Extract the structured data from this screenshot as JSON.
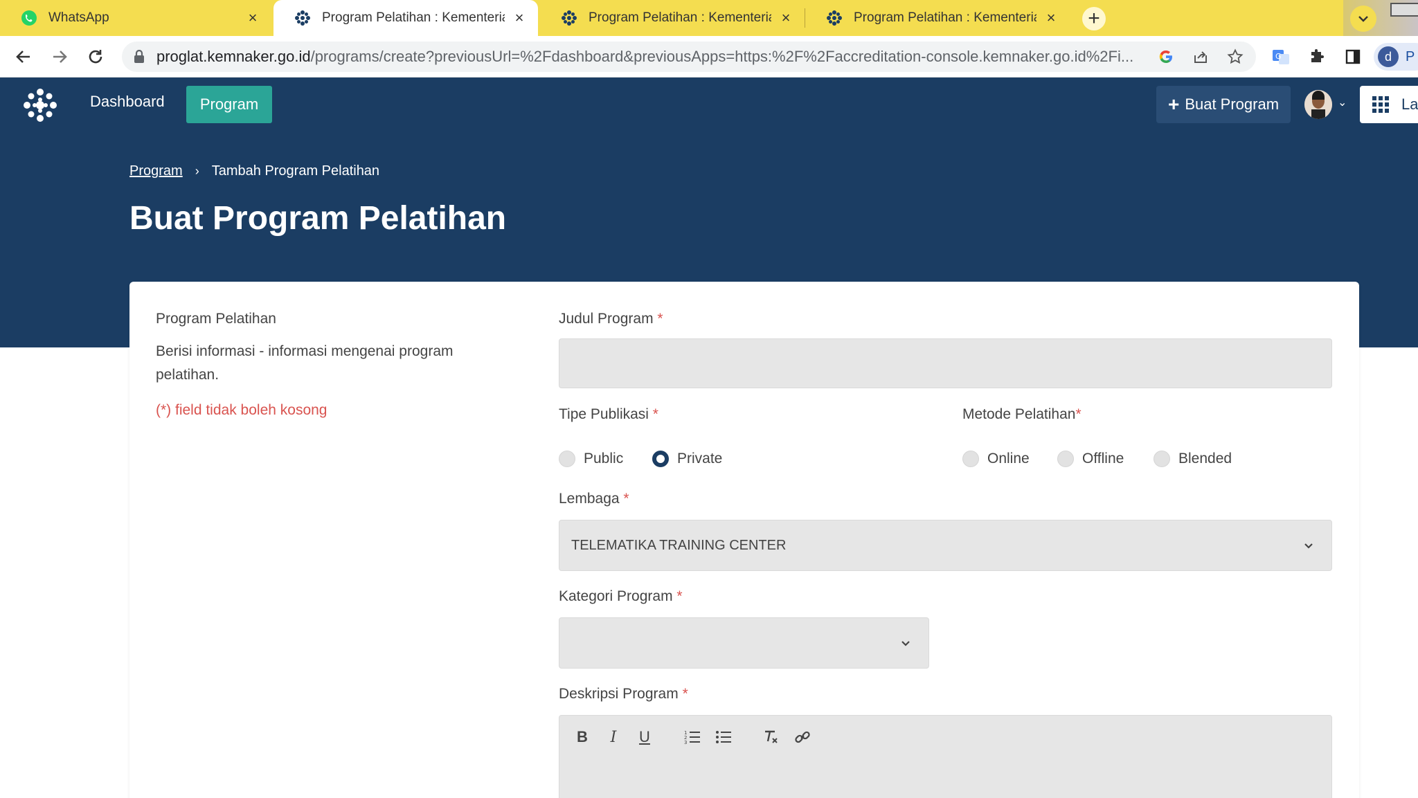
{
  "browser": {
    "tabs": [
      {
        "title": "WhatsApp",
        "icon": "whatsapp-icon"
      },
      {
        "title": "Program Pelatihan : Kementerian",
        "icon": "kemnaker-icon",
        "active": true
      },
      {
        "title": "Program Pelatihan : Kementerian",
        "icon": "kemnaker-icon"
      },
      {
        "title": "Program Pelatihan : Kementerian",
        "icon": "kemnaker-icon"
      }
    ],
    "new_tab": "+",
    "url_host": "proglat.kemnaker.go.id",
    "url_path": "/programs/create?previousUrl=%2Fdashboard&previousApps=https:%2F%2Faccreditation-console.kemnaker.go.id%2Fi...",
    "profile_initial": "d",
    "profile_label": "P"
  },
  "header": {
    "nav_dashboard": "Dashboard",
    "nav_program": "Program",
    "create_button": "Buat Program",
    "apps_label": "La"
  },
  "breadcrumb": {
    "parent": "Program",
    "current": "Tambah Program Pelatihan"
  },
  "page_title": "Buat Program Pelatihan",
  "section": {
    "title": "Program Pelatihan",
    "description": "Berisi informasi - informasi mengenai program pelatihan.",
    "note": "(*) field tidak boleh kosong"
  },
  "form": {
    "judul": {
      "label": "Judul Program",
      "value": ""
    },
    "tipe_publikasi": {
      "label": "Tipe Publikasi",
      "options": [
        "Public",
        "Private"
      ],
      "selected": "Private"
    },
    "metode_pelatihan": {
      "label": "Metode Pelatihan",
      "options": [
        "Online",
        "Offline",
        "Blended"
      ],
      "selected": ""
    },
    "lembaga": {
      "label": "Lembaga",
      "value": "TELEMATIKA TRAINING CENTER"
    },
    "kategori": {
      "label": "Kategori Program",
      "value": ""
    },
    "deskripsi": {
      "label": "Deskripsi Program",
      "toolbar": [
        "bold",
        "italic",
        "underline",
        "ordered-list",
        "bullet-list",
        "clear-format",
        "link"
      ]
    }
  },
  "colors": {
    "header_bg": "#1b3d63",
    "accent": "#2ba597",
    "required": "#d9534f",
    "tab_strip": "#f4dd50"
  }
}
